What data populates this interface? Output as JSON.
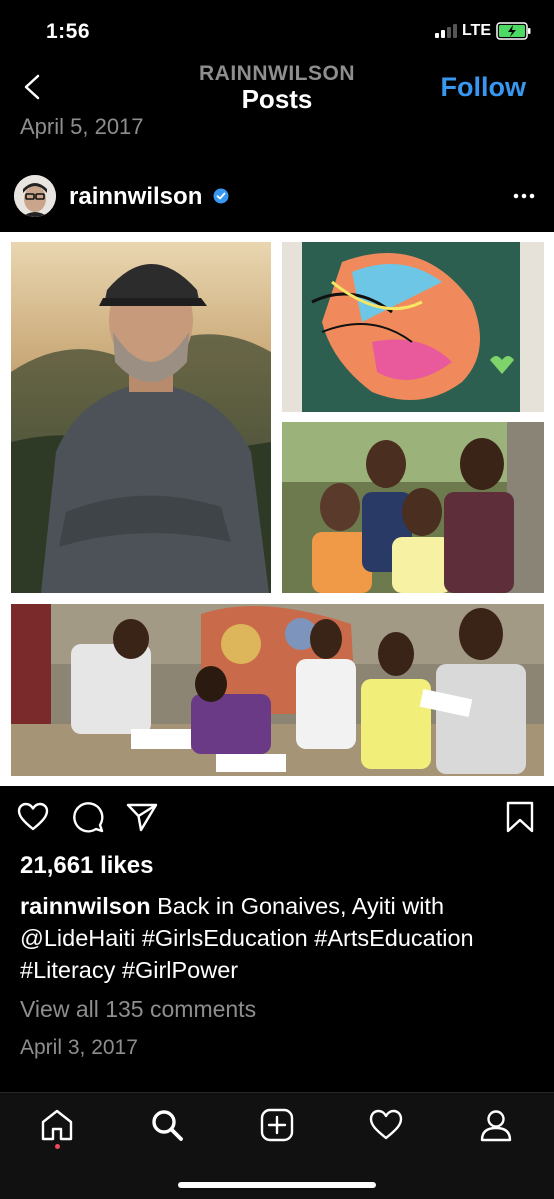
{
  "status_bar": {
    "time": "1:56",
    "network": "LTE",
    "battery_color": "#4cd964"
  },
  "header": {
    "username": "RAINNWILSON",
    "title": "Posts",
    "follow_label": "Follow",
    "back_icon": "chevron-left-icon"
  },
  "previous_post": {
    "date": "April 5, 2017"
  },
  "post": {
    "username": "rainnwilson",
    "verified": true,
    "photos": [
      {
        "name": "portrait-photo",
        "description": "man with cap, arms crossed"
      },
      {
        "name": "mural-photo",
        "description": "graffiti mural of face"
      },
      {
        "name": "girls-photo",
        "description": "group of girls"
      },
      {
        "name": "classroom-photo",
        "description": "kids writing outdoors"
      }
    ],
    "likes": "21,661 likes",
    "caption_user": "rainnwilson",
    "caption_text": "Back in Gonaives, Ayiti with @LideHaiti #GirlsEducation #ArtsEducation #Literacy #GirlPower",
    "view_comments": "View all 135 comments",
    "date": "April 3, 2017"
  },
  "tab_bar": {
    "items": [
      "home-icon",
      "search-icon",
      "add-post-icon",
      "activity-heart-icon",
      "profile-icon"
    ],
    "notification_color": "#ed4956"
  },
  "colors": {
    "accent": "#3897f0",
    "muted_text": "#8e8e8e"
  }
}
